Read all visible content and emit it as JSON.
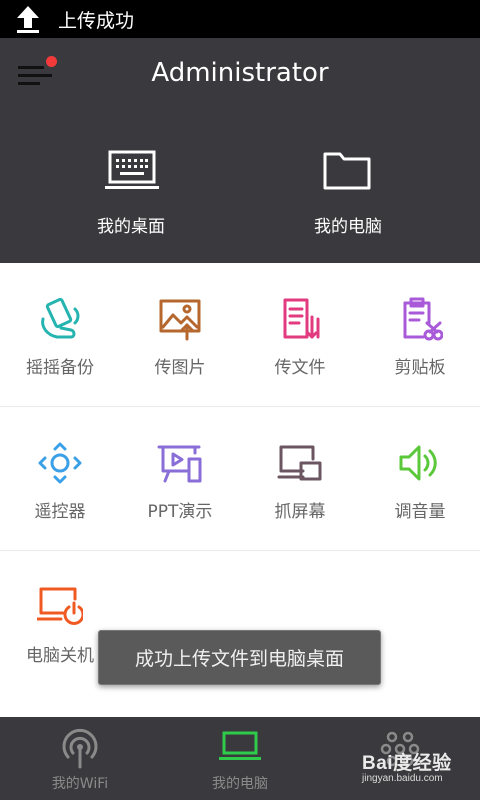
{
  "status_bar": {
    "upload_status": "上传成功"
  },
  "header": {
    "title": "Administrator",
    "tiles": [
      {
        "label": "我的桌面",
        "icon": "keyboard-laptop-icon"
      },
      {
        "label": "我的电脑",
        "icon": "folder-icon"
      }
    ]
  },
  "grid": {
    "row1": [
      {
        "label": "摇摇备份",
        "icon": "shake-phone-icon",
        "color": "#25b4b0"
      },
      {
        "label": "传图片",
        "icon": "image-upload-icon",
        "color": "#b5672e"
      },
      {
        "label": "传文件",
        "icon": "file-transfer-icon",
        "color": "#e23a7e"
      },
      {
        "label": "剪贴板",
        "icon": "clipboard-cut-icon",
        "color": "#a85ad9"
      }
    ],
    "row2": [
      {
        "label": "遥控器",
        "icon": "remote-dpad-icon",
        "color": "#3aa0e8"
      },
      {
        "label": "PPT演示",
        "icon": "ppt-present-icon",
        "color": "#8a6ed8"
      },
      {
        "label": "抓屏幕",
        "icon": "screen-capture-icon",
        "color": "#6a5560"
      },
      {
        "label": "调音量",
        "icon": "volume-icon",
        "color": "#5ac83a"
      }
    ],
    "row3": [
      {
        "label": "电脑关机",
        "icon": "pc-power-icon",
        "color": "#f05a22"
      }
    ]
  },
  "toast": {
    "message": "成功上传文件到电脑桌面"
  },
  "bottom_nav": {
    "tabs": [
      {
        "label": "我的WiFi",
        "icon": "wifi-antenna-icon"
      },
      {
        "label": "我的电脑",
        "icon": "laptop-icon",
        "active": true,
        "active_color": "#2ecc4a"
      },
      {
        "label": "",
        "icon": "dots-icon"
      }
    ]
  },
  "watermark": {
    "brand": "Bai度经验",
    "domain": "jingyan.baidu.com"
  }
}
